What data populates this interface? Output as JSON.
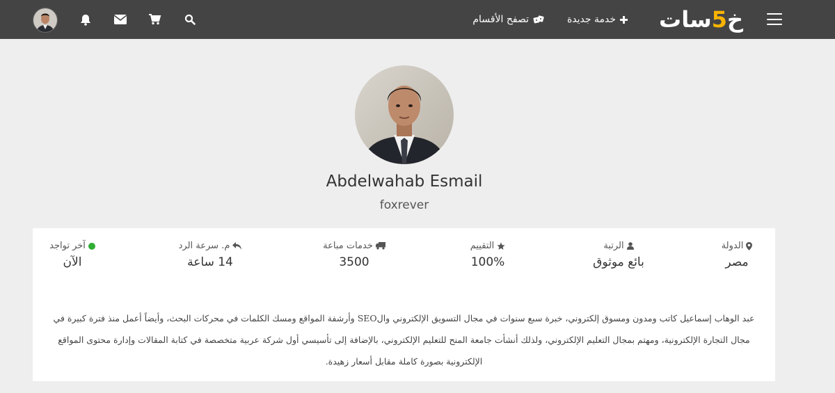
{
  "header": {
    "logo_main": "خمسات",
    "logo_parts": [
      "خ",
      "5",
      "سات"
    ],
    "new_service": "خدمة جديدة",
    "browse_categories": "تصفح الأقسام",
    "icons": [
      "menu-icon",
      "plus-icon",
      "dice-icon",
      "search-icon",
      "cart-icon",
      "envelope-icon",
      "bell-icon",
      "user-avatar"
    ]
  },
  "profile": {
    "name": "Abdelwahab Esmail",
    "username": "foxrever"
  },
  "stats": [
    {
      "label": "الدولة",
      "value": "مصر",
      "icon": "map-marker-icon"
    },
    {
      "label": "الرتبة",
      "value": "بائع موثوق",
      "icon": "user-icon"
    },
    {
      "label": "التقييم",
      "value": "100%",
      "icon": "star-icon"
    },
    {
      "label": "خدمات مباعة",
      "value": "3500",
      "icon": "truck-icon"
    },
    {
      "label": "م. سرعة الرد",
      "value": "14 ساعة",
      "icon": "reply-icon"
    },
    {
      "label": "آخر تواجد",
      "value": "الآن",
      "icon": "online-dot-icon"
    }
  ],
  "bio": "عبد الوهاب إسماعيل كاتب ومدون ومسوق إلكتروني، خبرة سبع سنوات في مجال التسويق الإلكتروني والSEO وأرشفة المواقع ومسك الكلمات في محركات البحث، وأيضاً أعمل منذ فترة كبيرة في مجال التجارة الإلكترونية، ومهتم بمجال التعليم الإلكتروني، ولذلك أنشأت جامعة المنح للتعليم الإلكتروني، بالإضافة إلى تأسيسي أول شركة عربية متخصصة في كتابة المقالات وإدارة محتوى المواقع الإلكترونية بصورة كاملة مقابل أسعار زهيدة.",
  "colors": {
    "topbar": "#444444",
    "logo_accent": "#f8b400",
    "online": "#2fad35",
    "page_bg": "#eeeeee"
  }
}
